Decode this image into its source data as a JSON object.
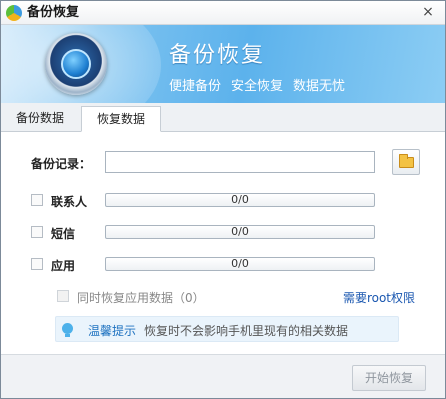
{
  "window": {
    "title": "备份恢复",
    "close_glyph": "×"
  },
  "banner": {
    "title": "备份恢复",
    "tags": [
      "便捷备份",
      "安全恢复",
      "数据无忧"
    ]
  },
  "tabs": [
    {
      "label": "备份数据",
      "selected": false
    },
    {
      "label": "恢复数据",
      "selected": true
    }
  ],
  "form": {
    "record_label": "备份记录：",
    "record_value": "",
    "record_placeholder": "",
    "folder_icon": "folder-icon"
  },
  "items": [
    {
      "label": "联系人",
      "progress_text": "0/0",
      "progress_fraction": 0,
      "checked": false
    },
    {
      "label": "短信",
      "progress_text": "0/0",
      "progress_fraction": 0,
      "checked": false
    },
    {
      "label": "应用",
      "progress_text": "0/0",
      "progress_fraction": 0,
      "checked": false
    }
  ],
  "sync_option": {
    "label": "同时恢复应用数据（0）",
    "checked": false,
    "disabled": true
  },
  "root_link": "需要root权限",
  "tip": {
    "title": "温馨提示",
    "text": "恢复时不会影响手机里现有的相关数据"
  },
  "footer": {
    "start_label": "开始恢复",
    "start_enabled": false
  },
  "colors": {
    "banner": "#5cb2ec",
    "link": "#1a57b0",
    "tip_title": "#1e72c0",
    "progress_fill": "#5fb3ec"
  }
}
